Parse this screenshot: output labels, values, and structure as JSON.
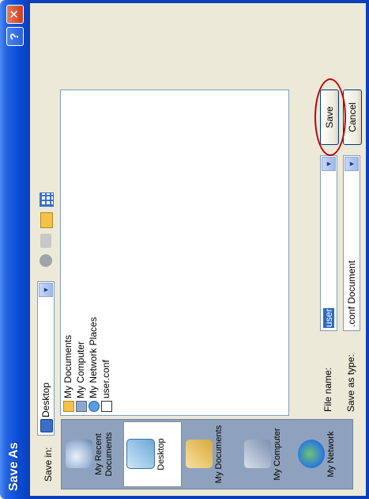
{
  "window": {
    "title": "Save As",
    "help_glyph": "?",
    "close_glyph": "✕"
  },
  "save_in": {
    "label": "Save in:",
    "value": "Desktop"
  },
  "toolbar": {
    "icons": [
      "back-icon",
      "up-folder-icon",
      "new-folder-icon",
      "views-icon"
    ]
  },
  "places": [
    {
      "label": "My Recent Documents",
      "icon": "recent-documents-icon"
    },
    {
      "label": "Desktop",
      "icon": "desktop-icon"
    },
    {
      "label": "My Documents",
      "icon": "my-documents-icon"
    },
    {
      "label": "My Computer",
      "icon": "my-computer-icon"
    },
    {
      "label": "My Network",
      "icon": "my-network-icon"
    }
  ],
  "files": [
    {
      "name": "My Documents",
      "icon": "folder-icon"
    },
    {
      "name": "My Computer",
      "icon": "computer-icon"
    },
    {
      "name": "My Network Places",
      "icon": "network-icon"
    },
    {
      "name": "user.conf",
      "icon": "conf-file-icon"
    }
  ],
  "file_name": {
    "label": "File name:",
    "value": "user"
  },
  "save_as_type": {
    "label": "Save as type:",
    "value": ".conf Document"
  },
  "buttons": {
    "save": "Save",
    "cancel": "Cancel"
  },
  "colors": {
    "title_bar": "#0a4dd6",
    "places_bar": "#8fa2bd",
    "highlight": "#c00000"
  }
}
